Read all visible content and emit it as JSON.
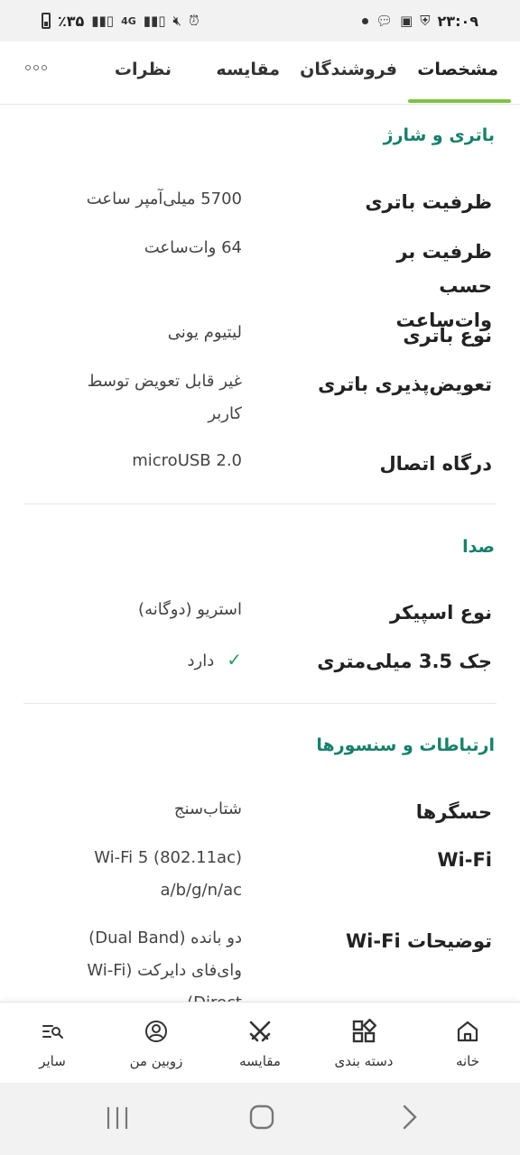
{
  "status_bar": {
    "time": "۲۳:۰۹",
    "battery": "٪۳۵",
    "network": "4G"
  },
  "tabs": [
    {
      "label": "مشخصات",
      "active": true
    },
    {
      "label": "فروشندگان",
      "active": false
    },
    {
      "label": "مقایسه",
      "active": false
    },
    {
      "label": "نظرات",
      "active": false
    }
  ],
  "sections": {
    "battery": {
      "title": "باتری و شارژ",
      "rows": [
        {
          "label": "ظرفیت باتری",
          "value": "5700 میلی‌آمپر ساعت"
        },
        {
          "label": "ظرفیت بر حسب وات‌ساعت",
          "value": "64 وات‌ساعت"
        },
        {
          "label": "نوع باتری",
          "value": "لیتیوم یونی"
        },
        {
          "label": "تعویض‌پذیری باتری",
          "value": "غیر قابل تعویض توسط کاربر"
        },
        {
          "label": "درگاه اتصال",
          "value": "microUSB 2.0"
        }
      ]
    },
    "sound": {
      "title": "صدا",
      "rows": [
        {
          "label": "نوع اسپیکر",
          "value": "استریو (دوگانه)"
        },
        {
          "label": "جک 3.5 میلی‌متری",
          "value": "دارد"
        }
      ]
    },
    "connectivity": {
      "title": "ارتباطات و سنسورها",
      "rows": [
        {
          "label": "حسگرها",
          "value": "شتاب‌سنج"
        },
        {
          "label": "Wi-Fi",
          "value": "Wi-Fi 5 (802.11ac) a/b/g/n/ac"
        },
        {
          "label": "توضیحات Wi-Fi",
          "value": "دو بانده (Dual Band) وای‌فای دایرکت (Wi-Fi Direct)"
        }
      ]
    }
  },
  "bottom_nav": [
    {
      "label": "خانه",
      "icon": "home-icon"
    },
    {
      "label": "دسته بندی",
      "icon": "category-grid-icon"
    },
    {
      "label": "مقایسه",
      "icon": "compare-swords-icon"
    },
    {
      "label": "زوبین من",
      "icon": "user-circle-icon"
    },
    {
      "label": "سایر",
      "icon": "more-list-search-icon"
    }
  ],
  "colors": {
    "accent": "#17806b",
    "tab_underline": "#7fc241",
    "check": "#2a9a63"
  }
}
